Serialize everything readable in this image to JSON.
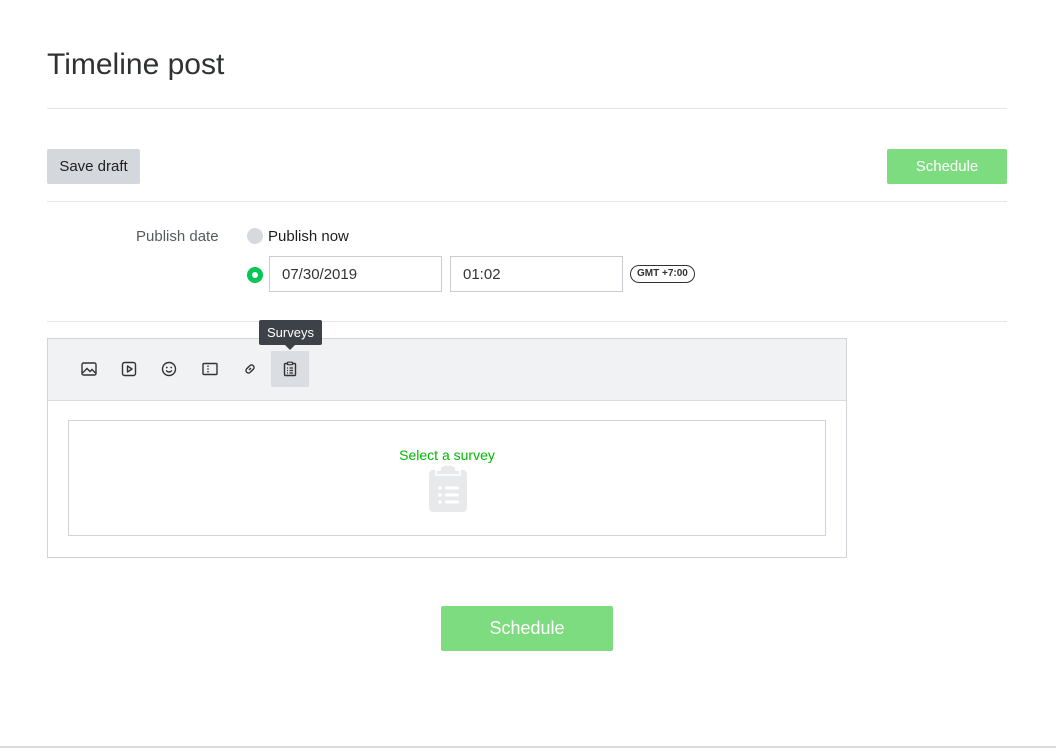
{
  "page": {
    "title": "Timeline post"
  },
  "actions": {
    "save_draft_label": "Save draft",
    "schedule_label": "Schedule",
    "schedule_color": "#7ddc7f"
  },
  "publish": {
    "label": "Publish date",
    "option_now_label": "Publish now",
    "selected_option": "scheduled",
    "date_value": "07/30/2019",
    "time_value": "01:02",
    "timezone": "GMT +7:00"
  },
  "editor": {
    "toolbar": [
      {
        "name": "image-icon"
      },
      {
        "name": "video-icon"
      },
      {
        "name": "sticker-icon"
      },
      {
        "name": "coupon-icon"
      },
      {
        "name": "link-icon"
      },
      {
        "name": "survey-icon",
        "active": true
      }
    ],
    "tooltip": "Surveys",
    "survey_prompt": "Select a survey"
  },
  "colors": {
    "accent": "#00b900",
    "radio_selected": "#06c755"
  }
}
